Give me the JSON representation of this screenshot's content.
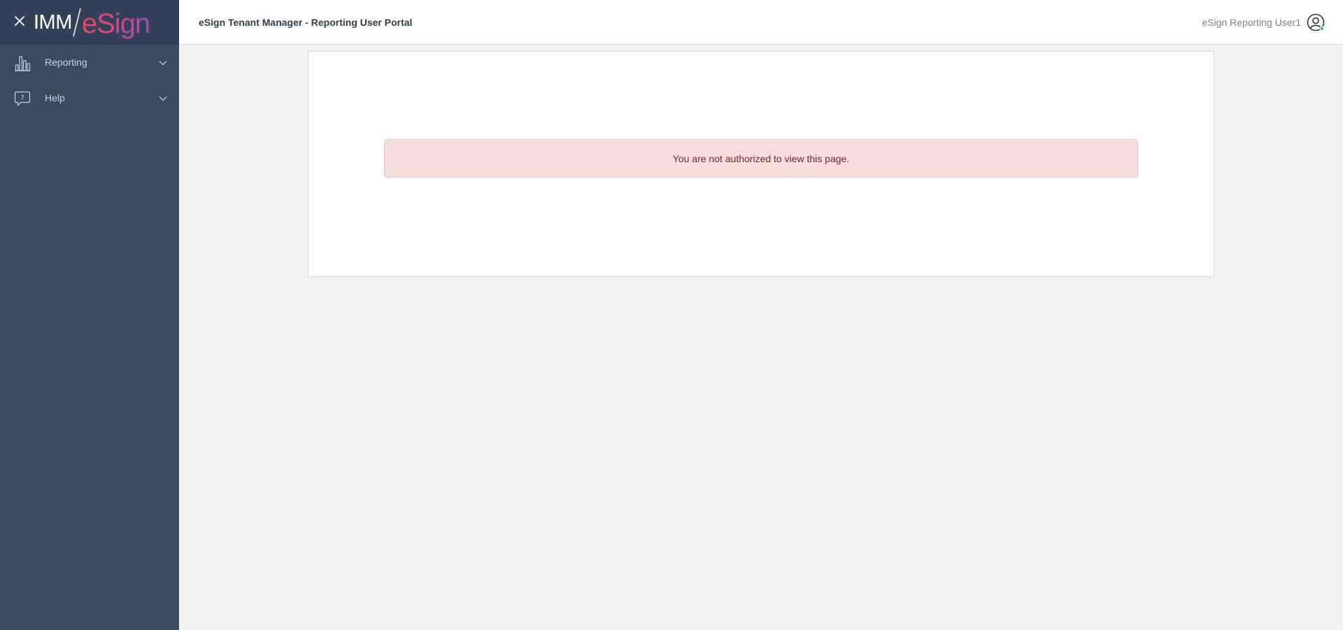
{
  "sidebar": {
    "logo": {
      "prefix": "IMM",
      "brand": "eSign"
    },
    "items": [
      {
        "label": "Reporting",
        "icon": "bar-chart-icon"
      },
      {
        "label": "Help",
        "icon": "help-chat-icon"
      }
    ]
  },
  "header": {
    "title": "eSign Tenant Manager - Reporting User Portal",
    "user_name": "eSign Reporting User1",
    "user_icon": "user-circle-icon"
  },
  "main": {
    "alert_message": "You are not authorized to view this page."
  },
  "colors": {
    "sidebar_bg": "#3a4a61",
    "sidebar_header_bg": "#33425a",
    "alert_bg": "#f8dbdb",
    "alert_text": "#6a2b2e",
    "status_dot": "#2ecc71"
  }
}
